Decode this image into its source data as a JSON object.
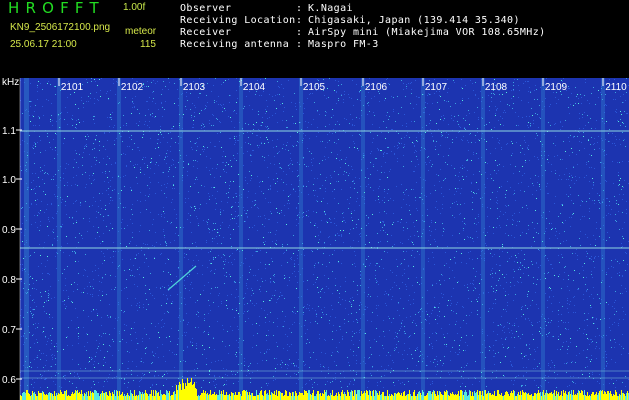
{
  "header": {
    "app_title": "HROFFT",
    "version": "1.00f",
    "filename": "KN9_2506172100.png",
    "datetime": "25.06.17 21:00",
    "meteor_label": "meteor",
    "meteor_count": "115"
  },
  "metadata": {
    "separator": ":",
    "rows": [
      {
        "label": "Observer",
        "value": "K.Nagai"
      },
      {
        "label": "Receiving Location",
        "value": "Chigasaki, Japan (139.414 35.340)"
      },
      {
        "label": "Receiver",
        "value": "AirSpy mini (Miakejima VOR 108.65MHz)"
      },
      {
        "label": "Receiving antenna",
        "value": "Maspro FM-3"
      }
    ]
  },
  "spectrogram": {
    "y_unit": "kHz",
    "y_ticks": [
      "1.1",
      "1.0",
      "0.9",
      "0.8",
      "0.7",
      "0.6"
    ],
    "time_ticks": [
      "2101",
      "2102",
      "2103",
      "2104",
      "2105",
      "2106",
      "2107",
      "2108",
      "2109",
      "2110"
    ],
    "colors": {
      "background": "#1c34b0",
      "noise_low": "#2a56d8",
      "noise_mid": "#3ba0e0",
      "noise_high": "#55e8e0",
      "gridline": "#8fd8e0",
      "baseline": "#ffff00",
      "text": "#ffffff"
    }
  }
}
